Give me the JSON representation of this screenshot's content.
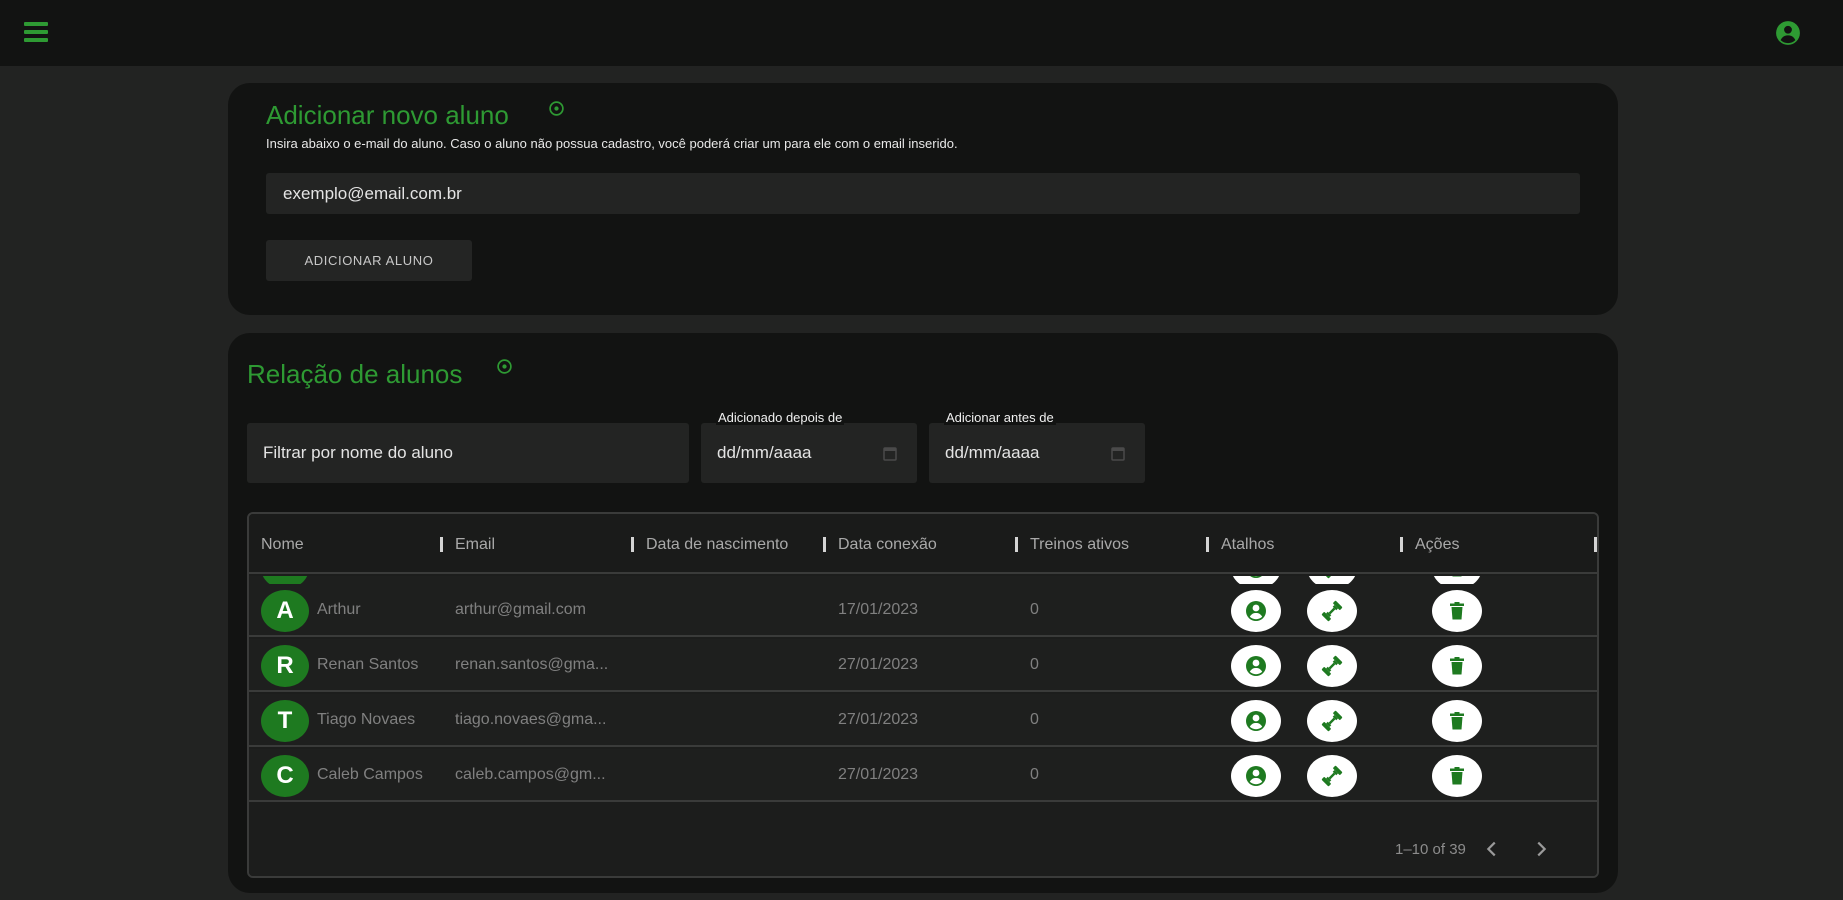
{
  "colors": {
    "accent": "#2e9a33",
    "avatar_bg": "#1e7a20",
    "page_bg": "#222322",
    "card_bg": "#121312",
    "appbar_bg": "#121312"
  },
  "appbar": {
    "menu_icon": "menu-icon",
    "account_icon": "account-circle-icon"
  },
  "add_student": {
    "title": "Adicionar novo aluno",
    "description": "Insira abaixo o e-mail do aluno. Caso o aluno não possua cadastro, você poderá criar um para ele com o email inserido.",
    "email_placeholder": "exemplo@email.com.br",
    "button_label": "ADICIONAR ALUNO"
  },
  "student_list": {
    "title": "Relação de alunos",
    "filters": {
      "name_placeholder": "Filtrar por nome do aluno",
      "added_after_label": "Adicionado depois de",
      "added_before_label": "Adicionar antes de",
      "date_placeholder": "dd/mm/aaaa"
    },
    "columns": [
      "Nome",
      "Email",
      "Data de nascimento",
      "Data conexão",
      "Treinos ativos",
      "Atalhos",
      "Ações"
    ],
    "rows": [
      {
        "initial": "A",
        "name": "Arthur",
        "email": "arthur@gmail.com",
        "birth_date": "",
        "connection_date": "17/01/2023",
        "active_workouts": "0"
      },
      {
        "initial": "R",
        "name": "Renan Santos",
        "email": "renan.santos@gma...",
        "birth_date": "",
        "connection_date": "27/01/2023",
        "active_workouts": "0"
      },
      {
        "initial": "T",
        "name": "Tiago Novaes",
        "email": "tiago.novaes@gma...",
        "birth_date": "",
        "connection_date": "27/01/2023",
        "active_workouts": "0"
      },
      {
        "initial": "C",
        "name": "Caleb Campos",
        "email": "caleb.campos@gm...",
        "birth_date": "",
        "connection_date": "27/01/2023",
        "active_workouts": "0"
      }
    ],
    "pagination": {
      "range_text": "1–10 of 39"
    }
  }
}
